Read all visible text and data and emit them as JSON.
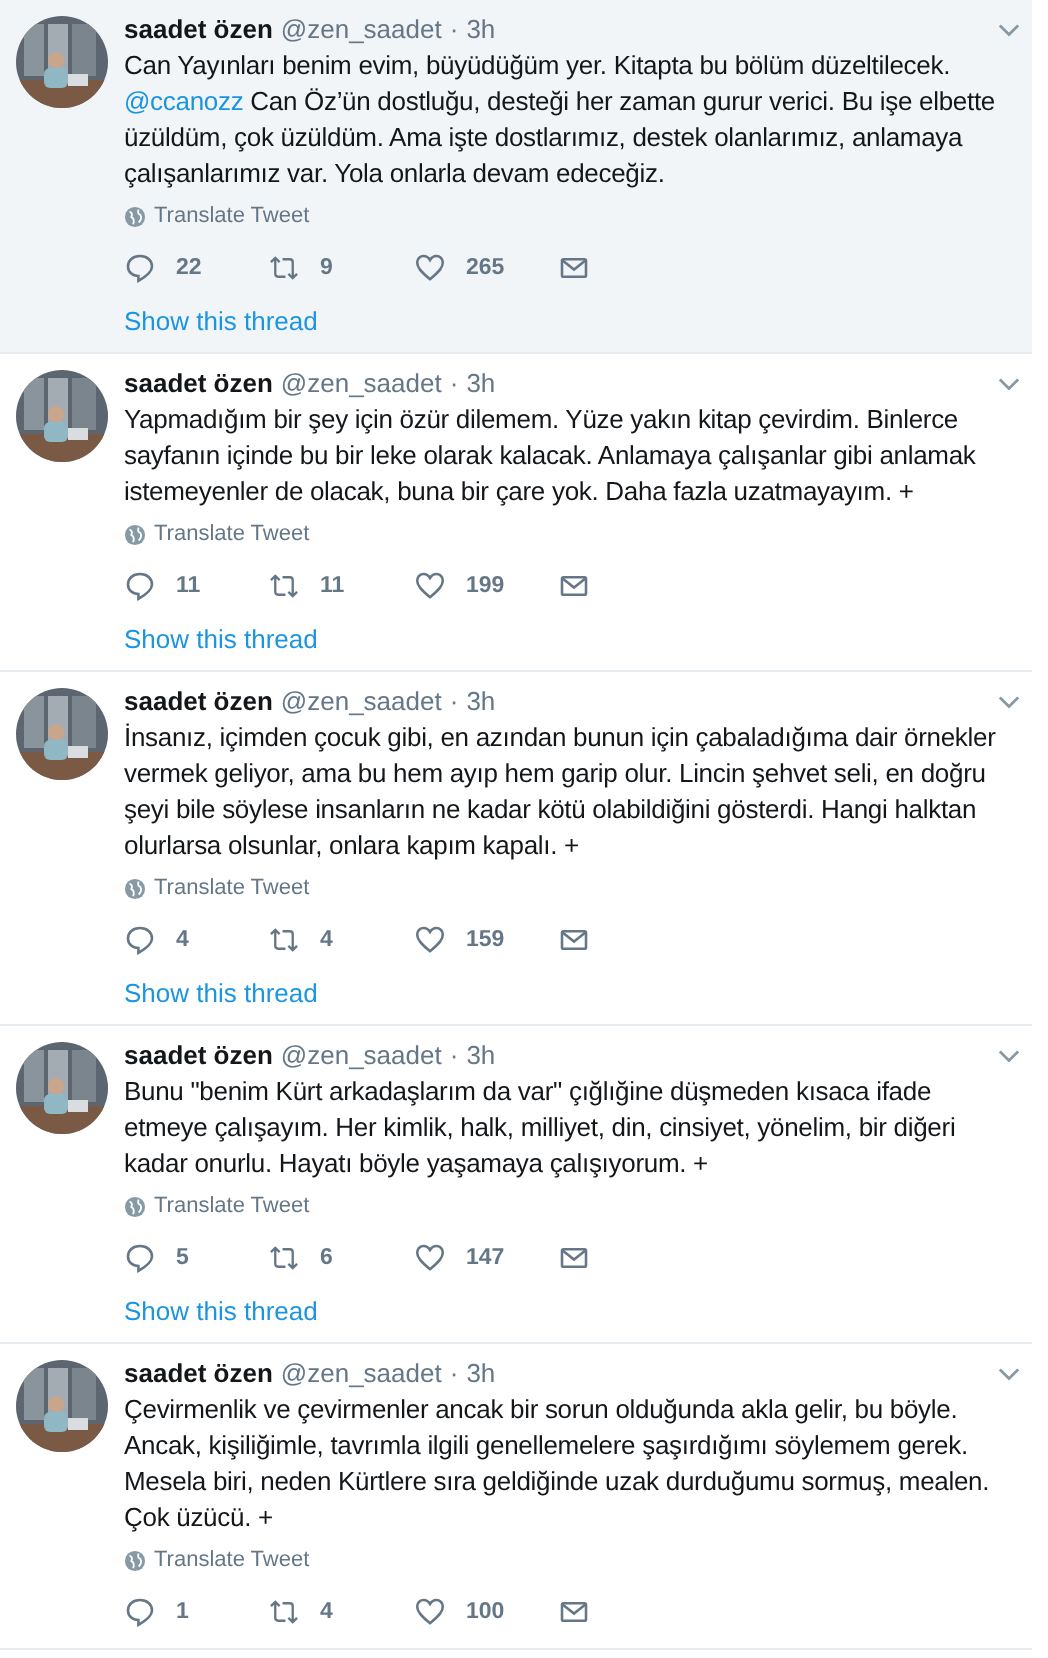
{
  "tweets": [
    {
      "name": "saadet özen",
      "handle": "@zen_saadet",
      "separator": "·",
      "time": "3h",
      "hovered": true,
      "text_parts": [
        {
          "kind": "text",
          "text": "Can Yayınları benim evim, büyüdüğüm yer. Kitapta bu bölüm düzeltilecek. "
        },
        {
          "kind": "mention",
          "text": "@ccanozz"
        },
        {
          "kind": "text",
          "text": " Can Öz’ün dostluğu, desteği her zaman gurur verici. Bu işe elbette üzüldüm, çok üzüldüm. Ama işte dostlarımız, destek olanlarımız, anlamaya çalışanlarımız var. Yola onlarla devam edeceğiz."
        }
      ],
      "translate": "Translate Tweet",
      "replies": "22",
      "retweets": "9",
      "likes": "265",
      "thread_link": "Show this thread"
    },
    {
      "name": "saadet özen",
      "handle": "@zen_saadet",
      "separator": "·",
      "time": "3h",
      "hovered": false,
      "text_parts": [
        {
          "kind": "text",
          "text": "Yapmadığım bir şey için özür dilemem. Yüze yakın kitap çevirdim. Binlerce sayfanın içinde bu bir leke olarak kalacak. Anlamaya çalışanlar gibi anlamak istemeyenler de olacak, buna bir çare yok. Daha fazla uzatmayayım. +"
        }
      ],
      "translate": "Translate Tweet",
      "replies": "11",
      "retweets": "11",
      "likes": "199",
      "thread_link": "Show this thread"
    },
    {
      "name": "saadet özen",
      "handle": "@zen_saadet",
      "separator": "·",
      "time": "3h",
      "hovered": false,
      "text_parts": [
        {
          "kind": "text",
          "text": "İnsanız, içimden çocuk gibi, en azından bunun için çabaladığıma dair örnekler vermek geliyor, ama bu hem ayıp hem garip olur. Lincin şehvet seli, en doğru şeyi bile söylese insanların ne kadar kötü olabildiğini gösterdi. Hangi halktan olurlarsa olsunlar, onlara kapım kapalı. +"
        }
      ],
      "translate": "Translate Tweet",
      "replies": "4",
      "retweets": "4",
      "likes": "159",
      "thread_link": "Show this thread"
    },
    {
      "name": "saadet özen",
      "handle": "@zen_saadet",
      "separator": "·",
      "time": "3h",
      "hovered": false,
      "text_parts": [
        {
          "kind": "text",
          "text": "Bunu \"benim Kürt arkadaşlarım da var\" çığlığine düşmeden kısaca ifade etmeye çalışayım. Her kimlik, halk, milliyet, din, cinsiyet, yönelim, bir diğeri kadar onurlu. Hayatı böyle yaşamaya çalışıyorum. +"
        }
      ],
      "translate": "Translate Tweet",
      "replies": "5",
      "retweets": "6",
      "likes": "147",
      "thread_link": "Show this thread"
    },
    {
      "name": "saadet özen",
      "handle": "@zen_saadet",
      "separator": "·",
      "time": "3h",
      "hovered": false,
      "text_parts": [
        {
          "kind": "text",
          "text": "Çevirmenlik ve çevirmenler ancak bir sorun olduğunda akla gelir, bu böyle. Ancak, kişiliğimle, tavrımla ilgili genellemelere şaşırdığımı söylemem gerek. Mesela biri, neden Kürtlere sıra geldiğinde uzak durduğumu sormuş, mealen. Çok üzücü. +"
        }
      ],
      "translate": "Translate Tweet",
      "replies": "1",
      "retweets": "4",
      "likes": "100"
    }
  ]
}
